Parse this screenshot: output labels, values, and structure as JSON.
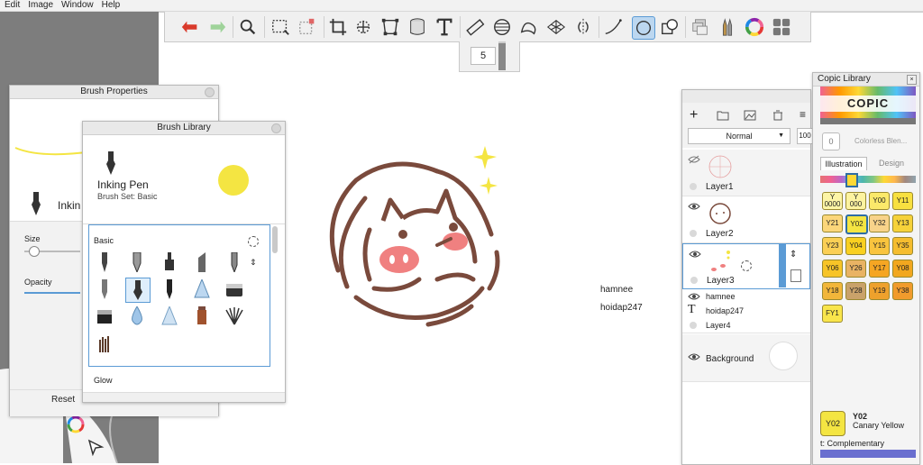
{
  "menu": [
    "Edit",
    "Image",
    "Window",
    "Help"
  ],
  "brush_size_value": "5",
  "brush_properties": {
    "title": "Brush Properties",
    "brush_name_partial": "Inkin",
    "size_label": "Size",
    "opacity_label": "Opacity",
    "reset_label": "Reset"
  },
  "brush_library": {
    "title": "Brush Library",
    "brush_name": "Inking Pen",
    "brush_set": "Brush Set: Basic",
    "section_basic": "Basic",
    "section_glow": "Glow"
  },
  "canvas_texts": [
    "hamnee",
    "hoidap247"
  ],
  "layers": {
    "blend_mode": "Normal",
    "opacity": "100",
    "items": [
      {
        "name": "Layer1"
      },
      {
        "name": "Layer2"
      },
      {
        "name": "Layer3"
      },
      {
        "name": "hamnee"
      },
      {
        "name": "hoidap247"
      },
      {
        "name": "Layer4"
      },
      {
        "name": "Background"
      }
    ]
  },
  "copic": {
    "title": "Copic Library",
    "logo": "COPIC",
    "colorless_label": "Colorless Blen...",
    "colorless_code": "0",
    "tab_illustration": "Illustration",
    "tab_design": "Design",
    "swatches": [
      "Y\n0000",
      "Y\n000",
      "Y00",
      "Y11",
      "Y21",
      "Y02",
      "Y32",
      "Y13",
      "Y23",
      "Y04",
      "Y15",
      "Y35",
      "Y06",
      "Y26",
      "Y17",
      "Y08",
      "Y18",
      "Y28",
      "Y19",
      "Y38",
      "FY1"
    ],
    "selected_code": "Y02",
    "selected_name": "Canary Yellow",
    "complementary_label": "t: Complementary"
  },
  "colors": {
    "accent": "#5b9bd5",
    "drawing_brown": "#7a4a3c",
    "sparkle_yellow": "#f4e542",
    "cheek_pink": "#f08080"
  }
}
